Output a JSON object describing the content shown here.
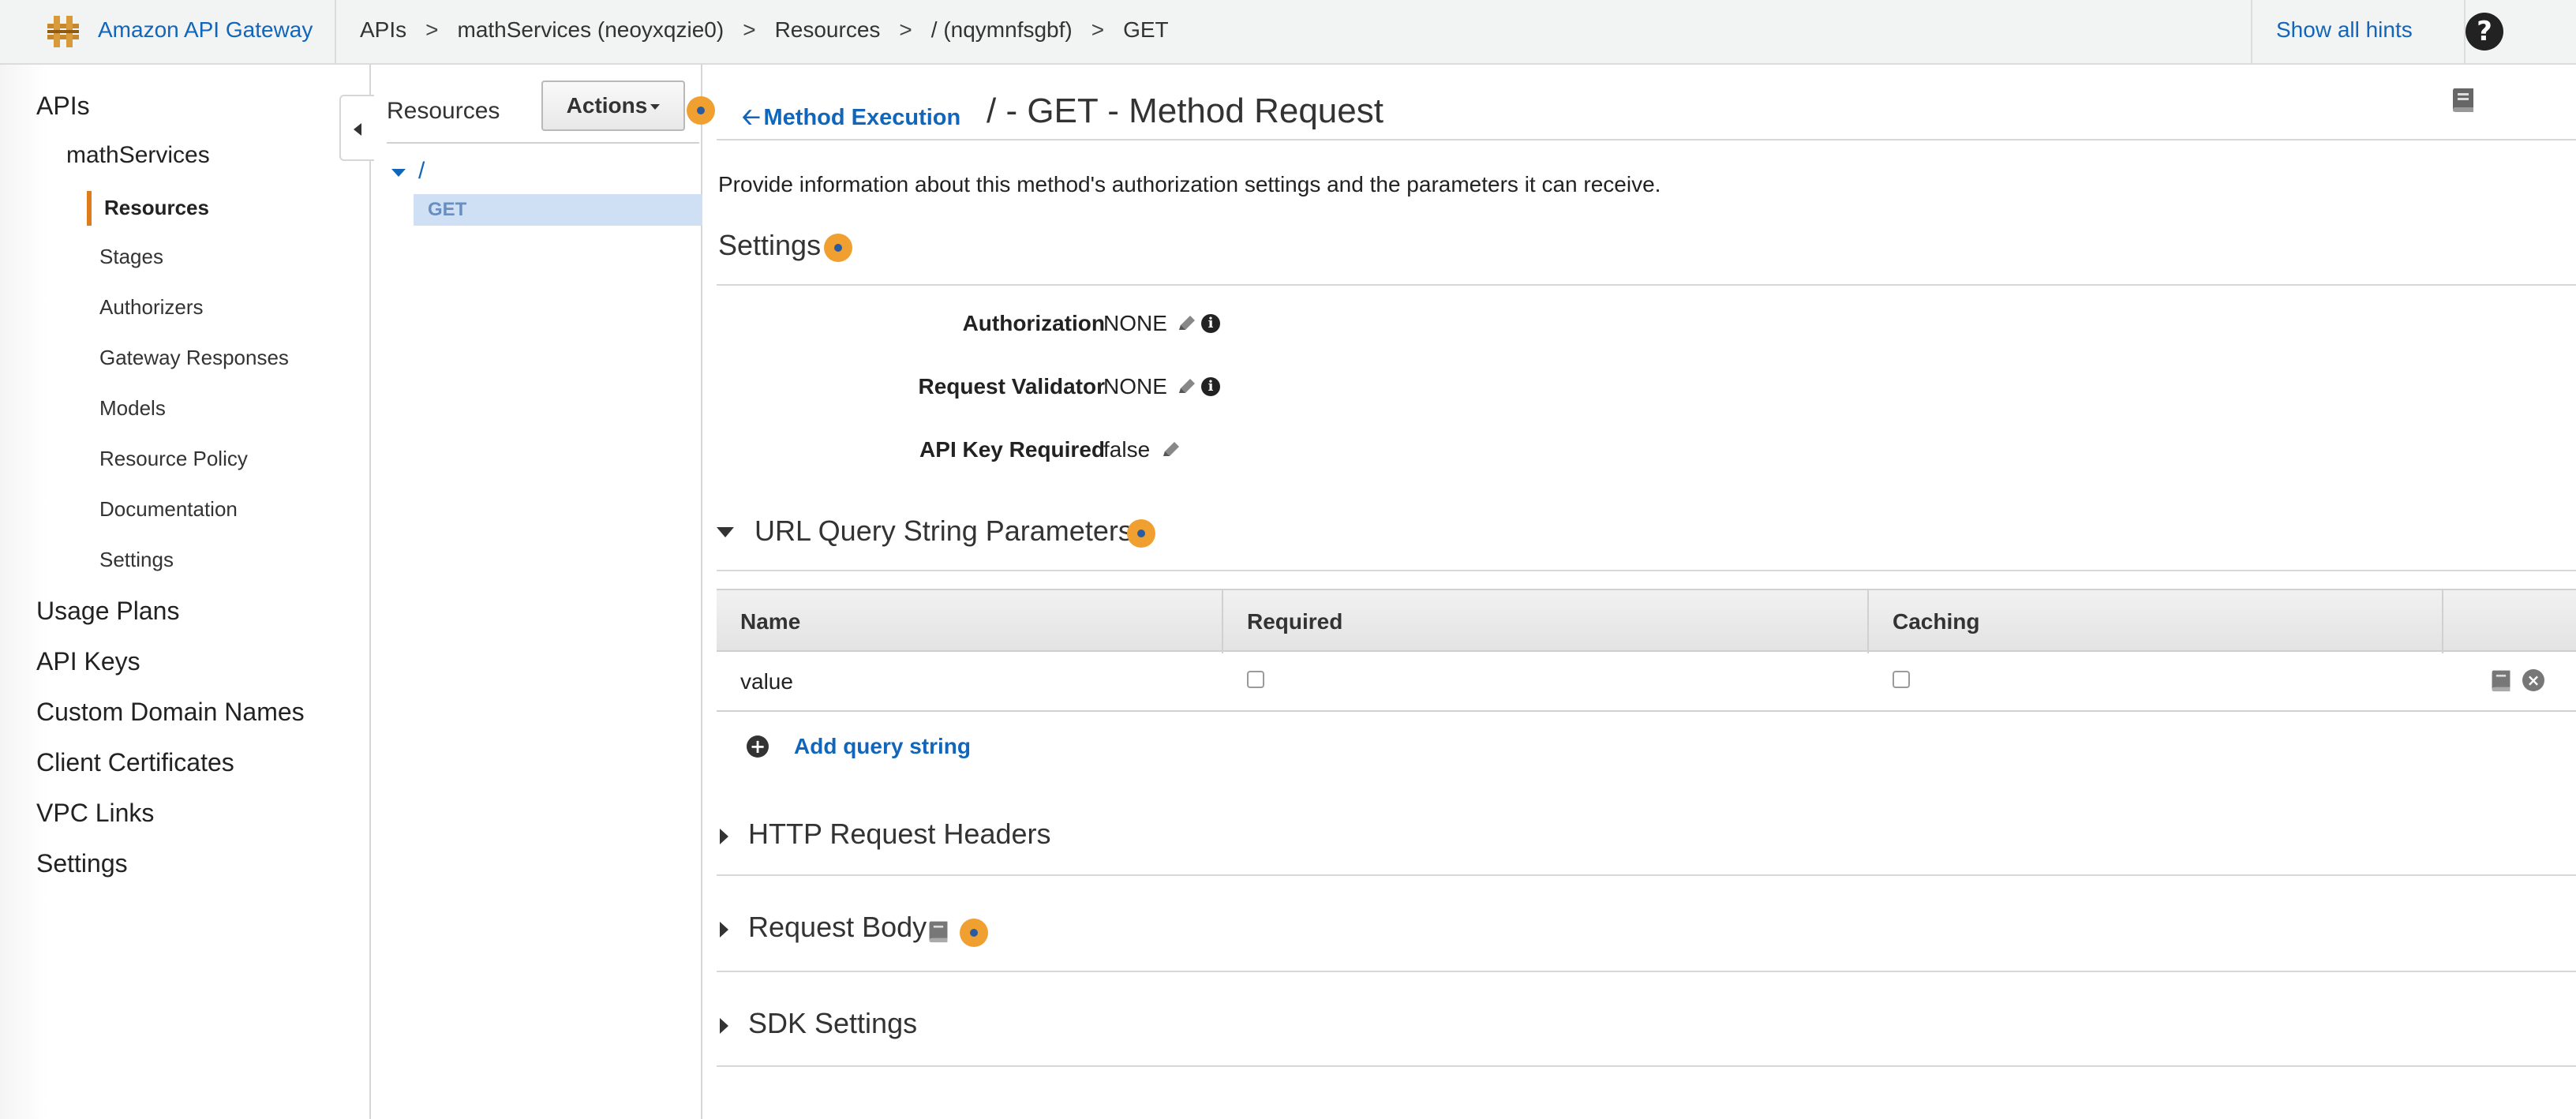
{
  "header": {
    "brand": "Amazon API Gateway",
    "breadcrumbs": [
      "APIs",
      "mathServices (neoyxqzie0)",
      "Resources",
      "/ (nqymnfsgbf)",
      "GET"
    ],
    "breadcrumb_separator": ">",
    "show_hints": "Show all hints",
    "help_icon": "?"
  },
  "leftnav": {
    "apis": "APIs",
    "api_name": "mathServices",
    "sub_items": [
      "Resources",
      "Stages",
      "Authorizers",
      "Gateway Responses",
      "Models",
      "Resource Policy",
      "Documentation",
      "Settings"
    ],
    "active_item": "Resources",
    "top_items": [
      "Usage Plans",
      "API Keys",
      "Custom Domain Names",
      "Client Certificates",
      "VPC Links",
      "Settings"
    ]
  },
  "resources": {
    "title": "Resources",
    "actions_label": "Actions",
    "root": "/",
    "selected_method": "GET"
  },
  "main": {
    "back_label": "Method Execution",
    "page_title": "/ - GET - Method Request",
    "description": "Provide information about this method's authorization settings and the parameters it can receive.",
    "settings": {
      "title": "Settings",
      "authorization_label": "Authorization",
      "authorization_value": "NONE",
      "validator_label": "Request Validator",
      "validator_value": "NONE",
      "api_key_label": "API Key Required",
      "api_key_value": "false"
    },
    "query_params": {
      "title": "URL Query String Parameters",
      "columns": [
        "Name",
        "Required",
        "Caching"
      ],
      "rows": [
        {
          "name": "value",
          "required": false,
          "caching": false
        }
      ],
      "add_label": "Add query string"
    },
    "sections": {
      "headers": "HTTP Request Headers",
      "body": "Request Body",
      "sdk": "SDK Settings"
    }
  },
  "colors": {
    "link": "#1166bb",
    "accent": "#e07b1a",
    "hint": "#f0a030",
    "selected_row": "#cfe0f5"
  }
}
